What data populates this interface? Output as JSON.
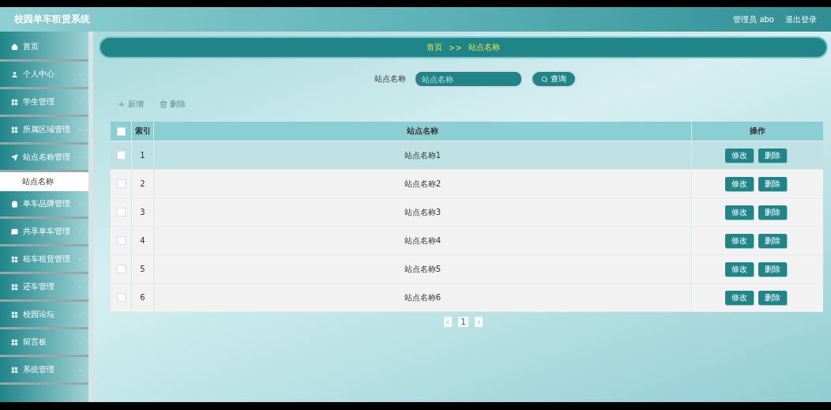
{
  "header": {
    "title": "校园单车租赁系统",
    "user": "管理员 abo",
    "logout": "退出登录"
  },
  "sidebar": {
    "items": [
      {
        "label": "首页"
      },
      {
        "label": "个人中心",
        "expanded": false
      },
      {
        "label": "学生管理",
        "expanded": false
      },
      {
        "label": "所属区域管理",
        "expanded": false
      },
      {
        "label": "站点名称管理",
        "expanded": true,
        "children": [
          {
            "label": "站点名称",
            "selected": true
          }
        ]
      },
      {
        "label": "单车品牌管理",
        "expanded": false
      },
      {
        "label": "共享单车管理",
        "expanded": false
      },
      {
        "label": "租车租赁管理",
        "expanded": false
      },
      {
        "label": "还车管理",
        "expanded": false
      },
      {
        "label": "校园论坛",
        "expanded": false
      },
      {
        "label": "留言板",
        "expanded": false
      },
      {
        "label": "系统管理",
        "expanded": false
      }
    ]
  },
  "breadcrumb": {
    "home": "首页",
    "separator": ">>",
    "current": "站点名称"
  },
  "search": {
    "label": "站点名称",
    "placeholder": "站点名称",
    "button": "查询"
  },
  "actions": {
    "add": "新增",
    "delete": "删除"
  },
  "table": {
    "columns": [
      "索引",
      "站点名称",
      "操作"
    ],
    "header_checked": false,
    "rows": [
      {
        "index": "1",
        "name": "站点名称1",
        "edit": "修改",
        "delete": "删除",
        "checked": false,
        "highlighted": true
      },
      {
        "index": "2",
        "name": "站点名称2",
        "edit": "修改",
        "delete": "删除",
        "checked": false,
        "highlighted": false
      },
      {
        "index": "3",
        "name": "站点名称3",
        "edit": "修改",
        "delete": "删除",
        "checked": false,
        "highlighted": false
      },
      {
        "index": "4",
        "name": "站点名称4",
        "edit": "修改",
        "delete": "删除",
        "checked": false,
        "highlighted": false
      },
      {
        "index": "5",
        "name": "站点名称5",
        "edit": "修改",
        "delete": "删除",
        "checked": false,
        "highlighted": false
      },
      {
        "index": "6",
        "name": "站点名称6",
        "edit": "修改",
        "delete": "删除",
        "checked": false,
        "highlighted": false
      }
    ]
  },
  "pagination": {
    "prev": "‹",
    "pages": [
      {
        "label": "1",
        "selected": true
      }
    ],
    "next": "›"
  }
}
